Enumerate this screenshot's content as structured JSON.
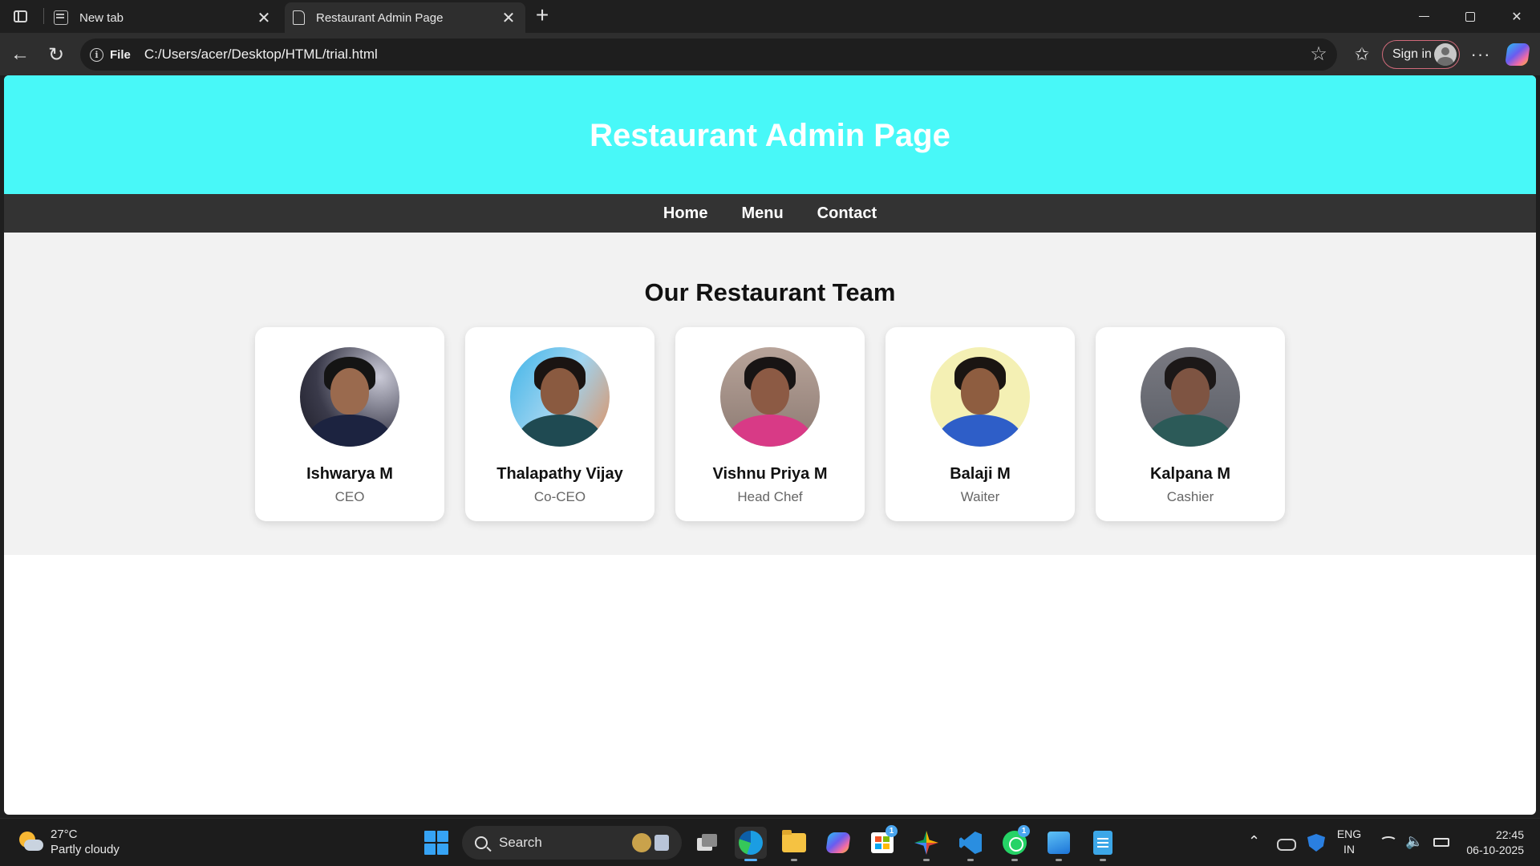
{
  "browser": {
    "tabs": [
      {
        "title": "New tab",
        "active": false
      },
      {
        "title": "Restaurant Admin Page",
        "active": true
      }
    ],
    "address": {
      "scheme_label": "File",
      "url": "C:/Users/acer/Desktop/HTML/trial.html"
    },
    "signin_label": "Sign in"
  },
  "page": {
    "header_title": "Restaurant Admin Page",
    "nav": [
      "Home",
      "Menu",
      "Contact"
    ],
    "section_title": "Our Restaurant Team",
    "team": [
      {
        "name": "Ishwarya M",
        "role": "CEO"
      },
      {
        "name": "Thalapathy Vijay",
        "role": "Co-CEO"
      },
      {
        "name": "Vishnu Priya M",
        "role": "Head Chef"
      },
      {
        "name": "Balaji M",
        "role": "Waiter"
      },
      {
        "name": "Kalpana M",
        "role": "Cashier"
      }
    ],
    "colors": {
      "header_bg": "#48f8f8",
      "nav_bg": "#333333",
      "section_bg": "#f2f2f2"
    }
  },
  "taskbar": {
    "weather": {
      "temp": "27°C",
      "condition": "Partly cloudy"
    },
    "search_label": "Search",
    "badges": {
      "store": "1",
      "whatsapp": "1"
    },
    "language": {
      "line1": "ENG",
      "line2": "IN"
    },
    "time": "22:45",
    "date": "06-10-2025"
  }
}
